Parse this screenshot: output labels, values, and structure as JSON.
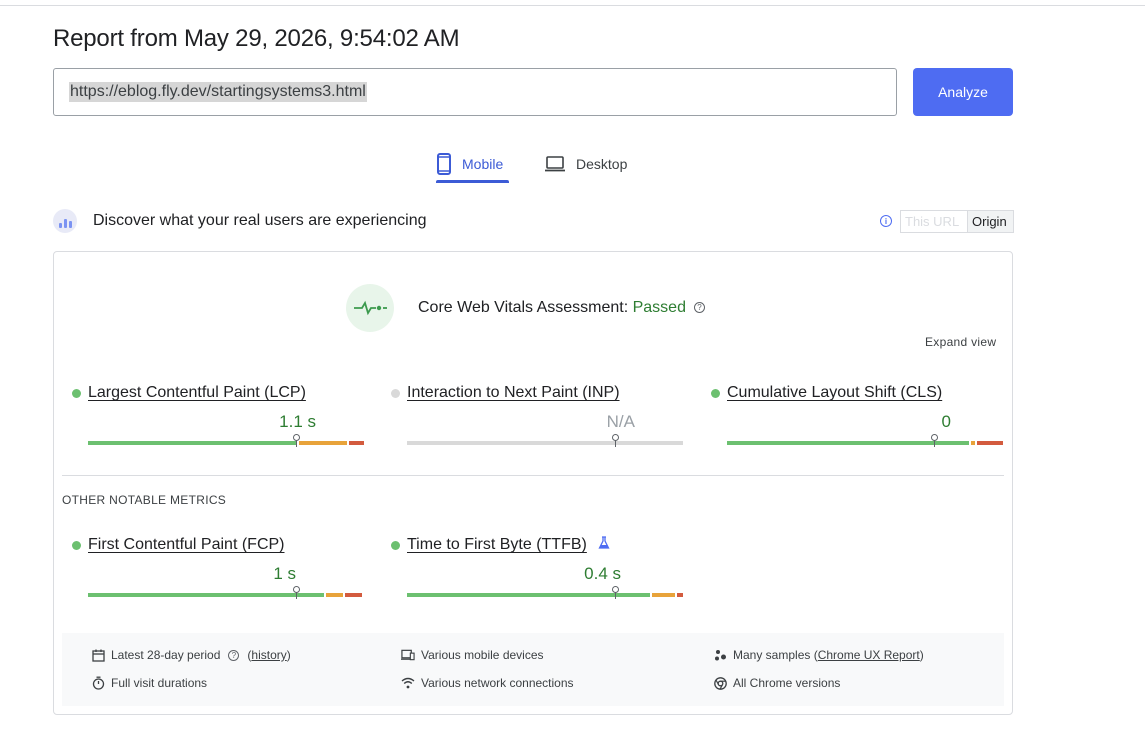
{
  "report": {
    "title": "Report from May 29, 2026, 9:54:02 AM",
    "url_value": "https://eblog.fly.dev/startingsystems3.html",
    "analyze_label": "Analyze"
  },
  "tabs": [
    {
      "label": "Mobile",
      "icon": "mobile-phone-icon",
      "selected": true
    },
    {
      "label": "Desktop",
      "icon": "laptop-icon",
      "selected": false
    }
  ],
  "field_data": {
    "title": "Discover what your real users are experiencing",
    "toggle": {
      "this_url": "This URL",
      "origin": "Origin",
      "selected": "Origin"
    },
    "assessment": {
      "label": "Core Web Vitals Assessment: ",
      "status": "Passed"
    },
    "expand_label": "Expand view",
    "core_metrics": [
      {
        "name": "Largest Contentful Paint (LCP)",
        "value": "1.1 s",
        "status": "good",
        "distribution": [
          0.76,
          0.18,
          0.06
        ]
      },
      {
        "name": "Interaction to Next Paint (INP)",
        "value": "N/A",
        "status": "none",
        "distribution": [
          1.0,
          0,
          0
        ]
      },
      {
        "name": "Cumulative Layout Shift (CLS)",
        "value": "0",
        "status": "good",
        "distribution": [
          0.88,
          0.02,
          0.1
        ]
      }
    ],
    "other_label": "OTHER NOTABLE METRICS",
    "other_metrics": [
      {
        "name": "First Contentful Paint (FCP)",
        "value": "1 s",
        "status": "good",
        "distribution": [
          0.86,
          0.07,
          0.07
        ],
        "experimental": false
      },
      {
        "name": "Time to First Byte (TTFB)",
        "value": "0.4 s",
        "status": "good",
        "distribution": [
          0.88,
          0.09,
          0.03
        ],
        "experimental": true
      }
    ],
    "footer": {
      "period": "Latest 28-day period",
      "history": "history",
      "devices": "Various mobile devices",
      "samples_prefix": "Many samples (",
      "samples_link": "Chrome UX Report",
      "samples_suffix": ")",
      "durations": "Full visit durations",
      "network": "Various network connections",
      "versions": "All Chrome versions"
    }
  },
  "colors": {
    "good": "#6cc070",
    "needs_improvement": "#e8a33a",
    "poor": "#d35b3e",
    "none": "#d9d9d9",
    "accent": "#4e6cf2"
  }
}
